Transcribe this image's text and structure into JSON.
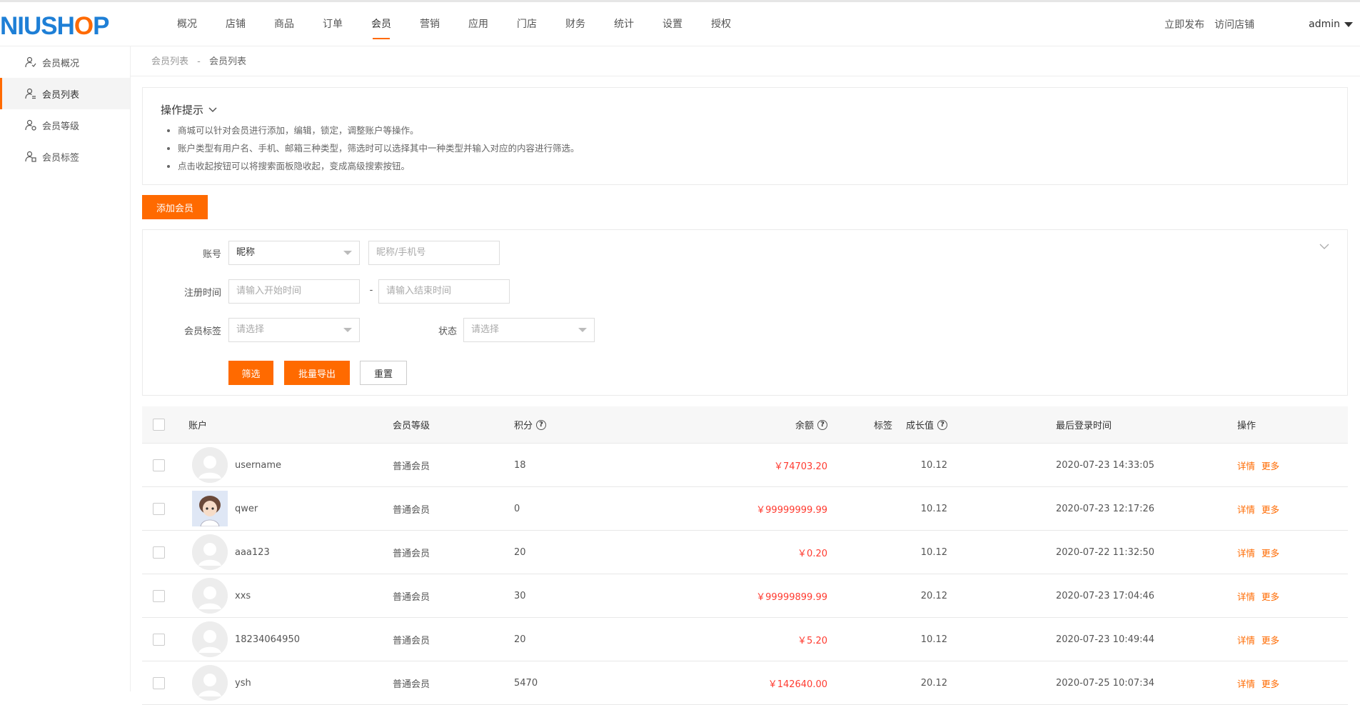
{
  "brand": {
    "part1": "NIUSHOP",
    "blue": "NIUSH",
    "orange": "O",
    "blue2": "P"
  },
  "nav": {
    "items": [
      "概况",
      "店铺",
      "商品",
      "订单",
      "会员",
      "营销",
      "应用",
      "门店",
      "财务",
      "统计",
      "设置",
      "授权"
    ],
    "active_index": 4
  },
  "header_right": {
    "publish": "立即发布",
    "visit": "访问店铺",
    "user": "admin"
  },
  "sidebar": {
    "items": [
      {
        "label": "会员概况",
        "icon": "user-check-icon"
      },
      {
        "label": "会员列表",
        "icon": "user-list-icon"
      },
      {
        "label": "会员等级",
        "icon": "user-level-icon"
      },
      {
        "label": "会员标签",
        "icon": "user-tag-icon"
      }
    ],
    "active_index": 1
  },
  "breadcrumb": {
    "parent": "会员列表",
    "sep": "-",
    "current": "会员列表"
  },
  "tips": {
    "title": "操作提示",
    "lines": [
      "商城可以针对会员进行添加，编辑，锁定，调整账户等操作。",
      "账户类型有用户名、手机、邮箱三种类型，筛选时可以选择其中一种类型并输入对应的内容进行筛选。",
      "点击收起按钮可以将搜索面板隐收起，变成高级搜索按钮。"
    ]
  },
  "add_button": "添加会员",
  "filter": {
    "account_label": "账号",
    "account_type_value": "昵称",
    "account_placeholder": "昵称/手机号",
    "reg_time_label": "注册时间",
    "start_placeholder": "请输入开始时间",
    "range_sep": "-",
    "end_placeholder": "请输入结束时间",
    "tag_label": "会员标签",
    "tag_placeholder": "请选择",
    "status_label": "状态",
    "status_placeholder": "请选择",
    "search_btn": "筛选",
    "export_btn": "批量导出",
    "reset_btn": "重置"
  },
  "table": {
    "headers": {
      "account": "账户",
      "level": "会员等级",
      "points": "积分",
      "balance": "余额",
      "growth": "成长值",
      "tag": "标签",
      "last_login": "最后登录时间",
      "ops": "操作"
    },
    "help_glyph": "?",
    "op_detail": "详情",
    "op_more": "更多",
    "rows": [
      {
        "name": "username",
        "level": "普通会员",
        "points": "18",
        "balance": "￥74703.20",
        "growth": "10.12",
        "tag": "",
        "last_login": "2020-07-23 14:33:05",
        "avatar": "default"
      },
      {
        "name": "qwer",
        "level": "普通会员",
        "points": "0",
        "balance": "￥99999999.99",
        "growth": "10.12",
        "tag": "",
        "last_login": "2020-07-23 12:17:26",
        "avatar": "photo"
      },
      {
        "name": "aaa123",
        "level": "普通会员",
        "points": "20",
        "balance": "￥0.20",
        "growth": "10.12",
        "tag": "",
        "last_login": "2020-07-22 11:32:50",
        "avatar": "default"
      },
      {
        "name": "xxs",
        "level": "普通会员",
        "points": "30",
        "balance": "￥99999899.99",
        "growth": "20.12",
        "tag": "",
        "last_login": "2020-07-23 17:04:46",
        "avatar": "default"
      },
      {
        "name": "18234064950",
        "level": "普通会员",
        "points": "20",
        "balance": "￥5.20",
        "growth": "10.12",
        "tag": "",
        "last_login": "2020-07-23 10:49:44",
        "avatar": "default"
      },
      {
        "name": "ysh",
        "level": "普通会员",
        "points": "5470",
        "balance": "￥142640.00",
        "growth": "20.12",
        "tag": "",
        "last_login": "2020-07-25 10:07:34",
        "avatar": "default"
      }
    ]
  },
  "colors": {
    "accent": "#ff6a00",
    "brand_blue": "#1e7fd6",
    "money": "#ff3b30"
  }
}
